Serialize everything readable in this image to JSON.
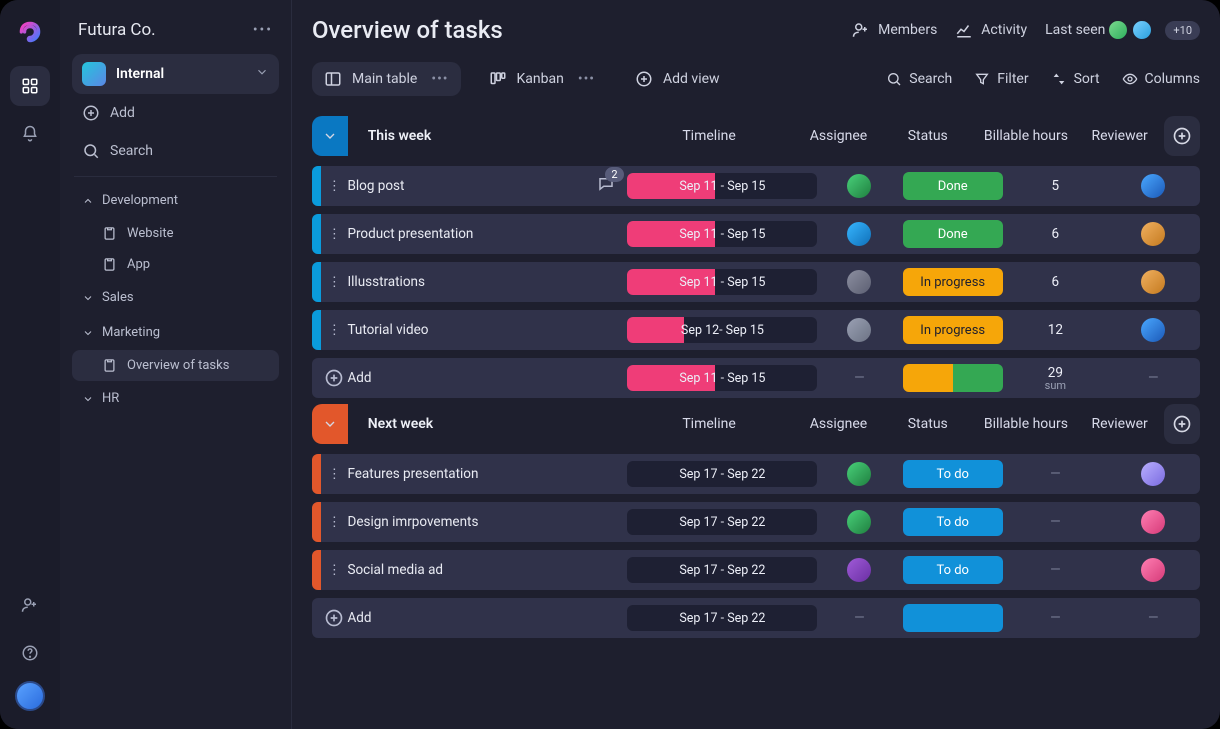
{
  "workspace": {
    "name": "Futura Co."
  },
  "project": {
    "name": "Internal"
  },
  "sidebar": {
    "add": "Add",
    "search": "Search",
    "sections": {
      "development": {
        "label": "Development",
        "website": "Website",
        "app": "App"
      },
      "sales": {
        "label": "Sales"
      },
      "marketing": {
        "label": "Marketing",
        "overview": "Overview of tasks"
      },
      "hr": {
        "label": "HR"
      }
    }
  },
  "page": {
    "title": "Overview of tasks"
  },
  "top": {
    "members": "Members",
    "activity": "Activity",
    "lastSeen": "Last seen",
    "moreCount": "+10"
  },
  "views": {
    "mainTable": "Main table",
    "kanban": "Kanban",
    "addView": "Add view"
  },
  "tools": {
    "search": "Search",
    "filter": "Filter",
    "sort": "Sort",
    "columns": "Columns"
  },
  "columns": {
    "timeline": "Timeline",
    "assignee": "Assignee",
    "status": "Status",
    "hours": "Billable  hours",
    "hours2": "Billable hours",
    "reviewer": "Reviewer"
  },
  "groups": [
    {
      "title": "This week",
      "color": "blue",
      "rows": [
        {
          "name": "Blog post",
          "timeline": "Sep 11 - Sep 15",
          "fill": 46,
          "assignee": "a1",
          "status": "Done",
          "statusKind": "done",
          "hours": "5",
          "reviewer": "r1",
          "comments": "2"
        },
        {
          "name": "Product presentation",
          "timeline": "Sep 11 - Sep 15",
          "fill": 46,
          "assignee": "a2",
          "status": "Done",
          "statusKind": "done",
          "hours": "6",
          "reviewer": "r2"
        },
        {
          "name": "Illusstrations",
          "timeline": "Sep 11 - Sep 15",
          "fill": 46,
          "assignee": "a3",
          "status": "In progress",
          "statusKind": "prog",
          "hours": "6",
          "reviewer": "r3"
        },
        {
          "name": "Tutorial video",
          "timeline": "Sep 12- Sep 15",
          "fill": 30,
          "assignee": "a4",
          "status": "In progress",
          "statusKind": "prog",
          "hours": "12",
          "reviewer": "r4"
        }
      ],
      "summary": {
        "add": "Add",
        "timeline": "Sep 11 - Sep 15",
        "fill": 46,
        "statusKind": "split",
        "hours": "29",
        "hoursLabel": "sum"
      }
    },
    {
      "title": "Next week",
      "color": "orange",
      "rows": [
        {
          "name": "Features presentation",
          "timeline": "Sep 17 - Sep 22",
          "fill": 0,
          "assignee": "b1",
          "status": "To do",
          "statusKind": "todo",
          "hours": "",
          "reviewer": "r5"
        },
        {
          "name": "Design imrpovements",
          "timeline": "Sep 17 - Sep 22",
          "fill": 0,
          "assignee": "b2",
          "status": "To do",
          "statusKind": "todo",
          "hours": "",
          "reviewer": "r6"
        },
        {
          "name": "Social media ad",
          "timeline": "Sep 17 - Sep 22",
          "fill": 0,
          "assignee": "b3",
          "status": "To do",
          "statusKind": "todo",
          "hours": "",
          "reviewer": "r7"
        }
      ],
      "summary": {
        "add": "Add",
        "timeline": "Sep 17 - Sep 22",
        "fill": 0,
        "statusKind": "todo",
        "hours": "",
        "hoursLabel": ""
      }
    }
  ],
  "avatars": {
    "a1": "linear-gradient(135deg,#49d17a,#1f7f3f)",
    "a2": "linear-gradient(135deg,#37b6ff,#0f6fb8)",
    "a3": "linear-gradient(135deg,#8c8fa0,#5c5f72)",
    "a4": "linear-gradient(135deg,#9aa1b4,#6c7284)",
    "b1": "linear-gradient(135deg,#49d17a,#1f7f3f)",
    "b2": "linear-gradient(135deg,#49d17a,#1f7f3f)",
    "b3": "linear-gradient(135deg,#a05bd8,#6a2fa3)",
    "r1": "linear-gradient(135deg,#4aa8ff,#1b59b8)",
    "r2": "linear-gradient(135deg,#f0b060,#c47a1f)",
    "r3": "linear-gradient(135deg,#f0b060,#c47a1f)",
    "r4": "linear-gradient(135deg,#4aa8ff,#1b59b8)",
    "r5": "linear-gradient(135deg,#b9afff,#7a6be0)",
    "r6": "linear-gradient(135deg,#ff7fb3,#d63a78)",
    "r7": "linear-gradient(135deg,#ff7fb3,#d63a78)"
  }
}
